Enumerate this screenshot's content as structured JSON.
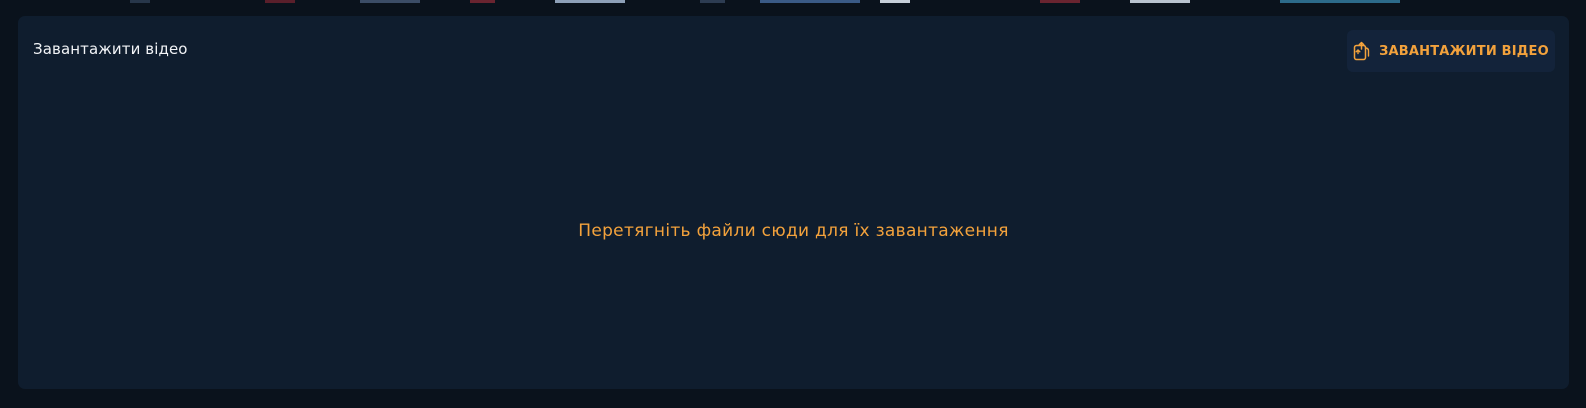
{
  "panel": {
    "title": "Завантажити відео",
    "upload_button_label": "ЗАВАНТАЖИТИ ВІДЕО",
    "upload_icon": "upload-file-icon",
    "drop_hint": "Перетягніть файли сюди для їх завантаження"
  },
  "colors": {
    "page_background": "#0a121c",
    "panel_background": "#0f1d2e",
    "button_background": "#13233a",
    "accent": "#f3a23c",
    "title_text": "#f2f4f7"
  }
}
